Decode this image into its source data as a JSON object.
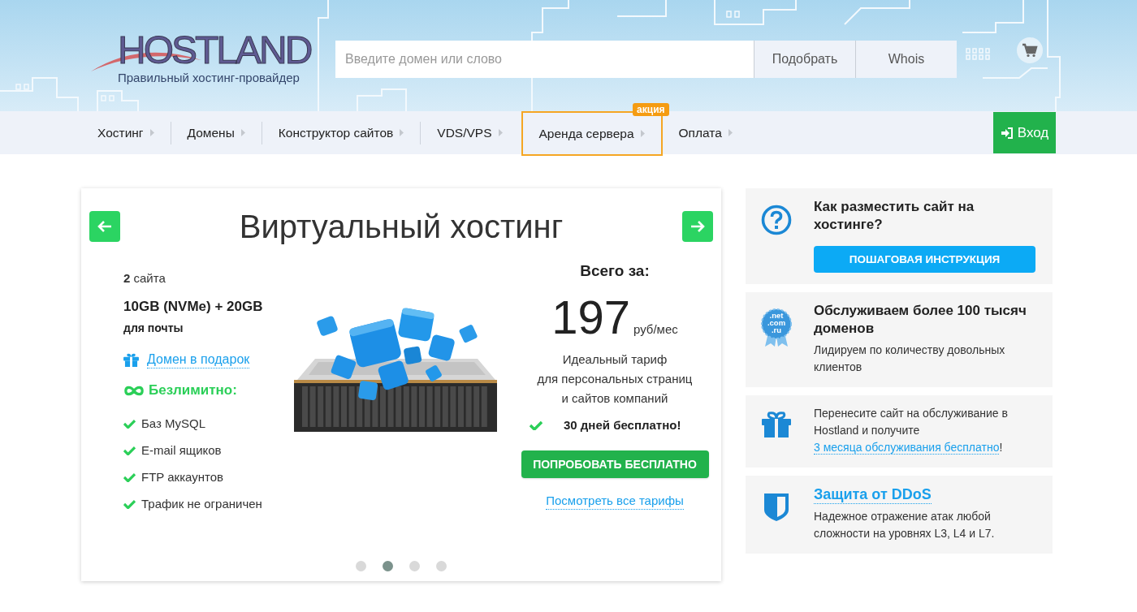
{
  "header": {
    "logo": {
      "wordmark": "HOSTLAND",
      "tagline": "Правильный хостинг-провайдер"
    },
    "search": {
      "placeholder": "Введите домен или слово",
      "buttons": [
        "Подобрать",
        "Whois"
      ]
    }
  },
  "nav": {
    "items": [
      {
        "label": "Хостинг",
        "highlighted": false
      },
      {
        "label": "Домены",
        "highlighted": false
      },
      {
        "label": "Конструктор сайтов",
        "highlighted": false
      },
      {
        "label": "VDS/VPS",
        "highlighted": false
      },
      {
        "label": "Аренда сервера",
        "highlighted": true,
        "badge": "акция"
      },
      {
        "label": "Оплата",
        "highlighted": false
      }
    ],
    "login_button": "Вход"
  },
  "slider": {
    "title": "Виртуальный хостинг",
    "features": {
      "sites": "**2** сайта",
      "storage": "10GB (NVMe) + 20GB",
      "storage_note": "для почты",
      "gift_link": "Домен в подарок",
      "unlimited_label": "Безлимитно:",
      "unlimited_items": [
        "Баз MySQL",
        "E-mail ящиков",
        "FTP аккаунтов",
        "Трафик не ограничен"
      ]
    },
    "price": {
      "label": "Всего за:",
      "amount": "197",
      "unit": "руб/мес",
      "description": "Идеальный тариф\nдля персональных страниц\nи сайтов компаний",
      "trial": "30 дней бесплатно!",
      "button": "ПОПРОБОВАТЬ БЕСПЛАТНО",
      "all_plans_link": "Посмотреть все тарифы"
    },
    "dots": [
      {
        "selected": false
      },
      {
        "selected": true
      },
      {
        "selected": false
      },
      {
        "selected": false
      }
    ]
  },
  "info_cards": [
    {
      "kind": "howto",
      "title": "Как разместить сайт на хостинге?",
      "button": "ПОШАГОВАЯ ИНСТРУКЦИЯ"
    },
    {
      "kind": "domains",
      "badge": [
        ".net",
        ".com",
        ".ru"
      ],
      "title": "Обслуживаем более 100 тысяч доменов",
      "text": "Лидируем по количеству довольных клиентов"
    },
    {
      "kind": "transfer",
      "text": "Перенесите сайт на обслуживание в Hostland и получите",
      "link": "3 месяца обслуживания бесплатно",
      "suffix": "!"
    },
    {
      "kind": "ddos",
      "link_title": "Защита от DDoS",
      "text": "Надежное отражение атак любой сложности на уровнях L3, L4 и L7."
    }
  ]
}
